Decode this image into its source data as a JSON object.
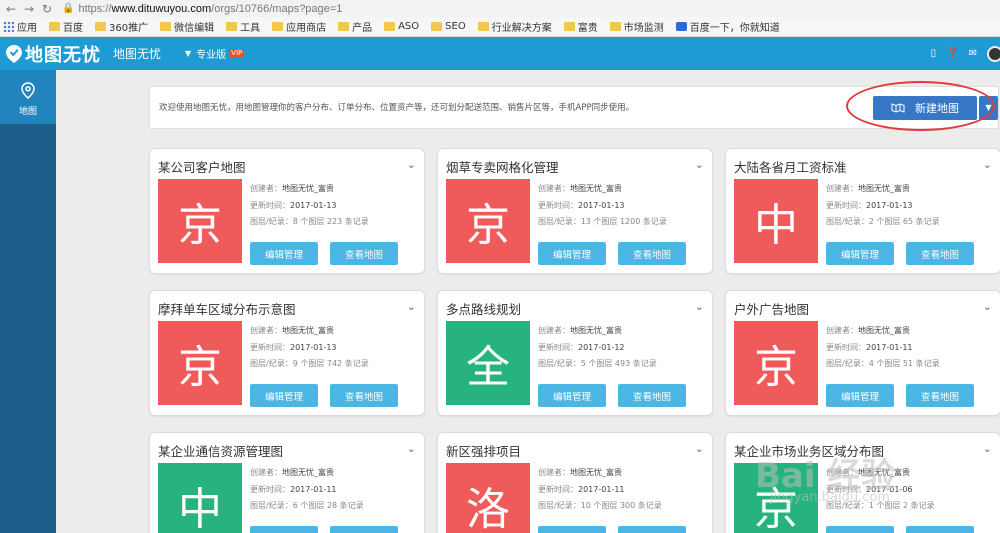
{
  "browser": {
    "url_scheme": "https://",
    "url_host": "www.dituwuyou.com",
    "url_path": "/orgs/10766/maps?page=1"
  },
  "bookmarks": [
    {
      "label": "应用",
      "icon": "apps-icon"
    },
    {
      "label": "百度",
      "icon": "folder-icon"
    },
    {
      "label": "360推广",
      "icon": "folder-icon"
    },
    {
      "label": "微信编辑",
      "icon": "folder-icon"
    },
    {
      "label": "工具",
      "icon": "folder-icon"
    },
    {
      "label": "应用商店",
      "icon": "folder-icon"
    },
    {
      "label": "产品",
      "icon": "folder-icon"
    },
    {
      "label": "ASO",
      "icon": "folder-icon"
    },
    {
      "label": "SEO",
      "icon": "folder-icon"
    },
    {
      "label": "行业解决方案",
      "icon": "folder-icon"
    },
    {
      "label": "富贵",
      "icon": "folder-icon"
    },
    {
      "label": "市场监测",
      "icon": "folder-icon"
    },
    {
      "label": "百度一下，你就知道",
      "icon": "baidu-paw-icon"
    }
  ],
  "header": {
    "logo_text": "地图无忧",
    "org_name": "地图无忧",
    "edition": "专业版",
    "vip_badge": "VIP",
    "brand_color": "#1f9bd4"
  },
  "sidebar": {
    "items": [
      {
        "label": "地图",
        "icon": "map-pin-icon",
        "active": true
      }
    ]
  },
  "welcome": {
    "text": "欢迎使用地图无忧，用地图管理你的客户分布、订单分布、位置资产等，还可划分配送范围、销售片区等，手机APP同步使用。",
    "new_map_label": "新建地图"
  },
  "labels": {
    "creator": "创建者：",
    "updated": "更新时间：",
    "layers": "图层/纪录：",
    "edit_btn": "编辑管理",
    "view_btn": "查看地图"
  },
  "maps": [
    {
      "title": "某公司客户地图",
      "char": "京",
      "color": "#ef5b5b",
      "creator": "地图无忧_富贵",
      "updated": "2017-01-13",
      "layers": "8 个图层 223 条记录"
    },
    {
      "title": "烟草专卖网格化管理",
      "char": "京",
      "color": "#ef5b5b",
      "creator": "地图无忧_富贵",
      "updated": "2017-01-13",
      "layers": "13 个图层 1200 条记录"
    },
    {
      "title": "大陆各省月工资标准",
      "char": "中",
      "color": "#ef5b5b",
      "creator": "地图无忧_富贵",
      "updated": "2017-01-13",
      "layers": "2 个图层 65 条记录"
    },
    {
      "title": "摩拜单车区域分布示意图",
      "char": "京",
      "color": "#ef5b5b",
      "creator": "地图无忧_富贵",
      "updated": "2017-01-13",
      "layers": "9 个图层 742 条记录"
    },
    {
      "title": "多点路线规划",
      "char": "全",
      "color": "#26b37d",
      "creator": "地图无忧_富贵",
      "updated": "2017-01-12",
      "layers": "5 个图层 493 条记录"
    },
    {
      "title": "户外广告地图",
      "char": "京",
      "color": "#ef5b5b",
      "creator": "地图无忧_富贵",
      "updated": "2017-01-11",
      "layers": "4 个图层 51 条记录"
    },
    {
      "title": "某企业通信资源管理图",
      "char": "中",
      "color": "#26b37d",
      "creator": "地图无忧_富贵",
      "updated": "2017-01-11",
      "layers": "6 个图层 28 条记录"
    },
    {
      "title": "新区强排项目",
      "char": "洛",
      "color": "#ef5b5b",
      "creator": "地图无忧_富贵",
      "updated": "2017-01-11",
      "layers": "10 个图层 300 条记录"
    },
    {
      "title": "某企业市场业务区域分布图",
      "char": "京",
      "color": "#26b37d",
      "creator": "地图无忧_富贵",
      "updated": "2017-01-06",
      "layers": "1 个图层 2 条记录"
    }
  ],
  "watermark": {
    "text": "Bai 经验",
    "sub": "jingyan.baidu.com"
  }
}
